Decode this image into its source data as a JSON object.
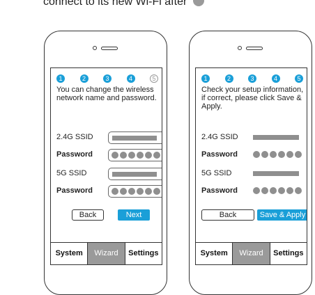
{
  "header": {
    "text": "connect to its new Wi-Fi after",
    "badge_number": "5"
  },
  "left": {
    "steps": [
      "1",
      "2",
      "3",
      "4",
      "5"
    ],
    "active_steps": 4,
    "instruction": "You can change the wireless network name and password.",
    "ssid24_label": "2.4G SSID",
    "password_label": "Password",
    "ssid5_label": "5G SSID",
    "password2_label": "Password",
    "back": "Back",
    "next": "Next",
    "tabs": {
      "system": "System",
      "wizard": "Wizard",
      "settings": "Settings"
    }
  },
  "right": {
    "steps": [
      "1",
      "2",
      "3",
      "4",
      "5"
    ],
    "active_steps": 5,
    "instruction": "Check your setup information, if correct, please click Save & Apply.",
    "ssid24_label": "2.4G SSID",
    "password_label": "Password",
    "ssid5_label": "5G SSID",
    "password2_label": "Password",
    "back": "Back",
    "save": "Save & Apply",
    "tabs": {
      "system": "System",
      "wizard": "Wizard",
      "settings": "Settings"
    }
  },
  "colors": {
    "accent": "#1a9fd8",
    "gray": "#9a9a9a"
  },
  "icons": {
    "camera": "camera-icon",
    "speaker": "speaker-icon",
    "masked": "masked-dots-icon"
  }
}
